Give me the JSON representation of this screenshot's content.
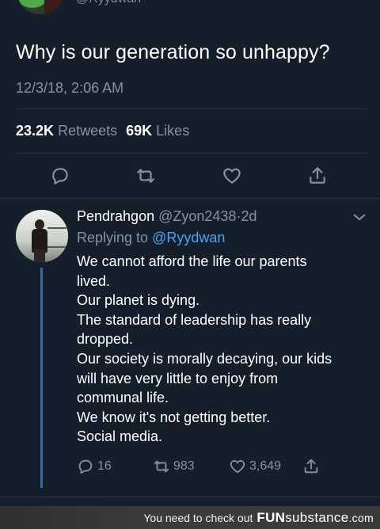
{
  "main_tweet": {
    "handle": "@Ryydwan",
    "text": "Why is our generation so unhappy?",
    "timestamp": "12/3/18, 2:06 AM",
    "retweets_count": "23.2K",
    "retweets_label": "Retweets",
    "likes_count": "69K",
    "likes_label": "Likes"
  },
  "actions": {
    "icons": [
      "reply-icon",
      "retweet-icon",
      "like-icon",
      "share-icon"
    ]
  },
  "reply": {
    "name": "Pendrahgon",
    "handle": "@Zyon2438",
    "separator": "·",
    "time": "2d",
    "replying_prefix": "Replying to",
    "replying_handle": "@Ryydwan",
    "lines": [
      "We cannot afford the life our parents",
      "lived.",
      "Our planet is dying.",
      "The standard of leadership has really",
      "dropped.",
      "Our society is morally decaying, our kids",
      "will have very little to enjoy from",
      "communal life.",
      "We know it's not getting better.",
      "Social media."
    ],
    "reply_count": "16",
    "retweet_count": "983",
    "like_count": "3,649"
  },
  "banner": {
    "text": "You need to check out",
    "brand_bold": "FUN",
    "brand_rest": "substance",
    "brand_suffix": ".com"
  },
  "colors": {
    "background": "#151f2c",
    "muted": "#8494a4",
    "link": "#4ba3ef",
    "thread": "#2f6ea8"
  }
}
